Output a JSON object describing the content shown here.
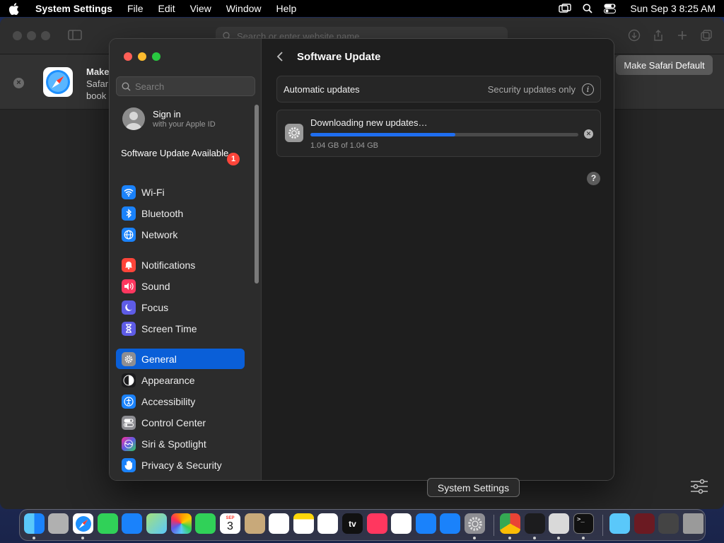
{
  "menubar": {
    "app_name": "System Settings",
    "items": [
      "File",
      "Edit",
      "View",
      "Window",
      "Help"
    ],
    "clock": "Sun Sep 3  8:25 AM"
  },
  "safari": {
    "address_placeholder": "Search or enter website name",
    "banner_title": "Make",
    "banner_line2": "Safar",
    "banner_line3": "book",
    "make_default_label": "Make Safari Default"
  },
  "settings": {
    "search_placeholder": "Search",
    "signin_name": "Sign in",
    "signin_sub": "with your Apple ID",
    "update_available": "Software Update Available",
    "update_badge": "1",
    "nav": [
      {
        "label": "Wi-Fi",
        "icon": "wifi-icon",
        "color": "#1a82fb"
      },
      {
        "label": "Bluetooth",
        "icon": "bluetooth-icon",
        "color": "#1a82fb"
      },
      {
        "label": "Network",
        "icon": "globe-icon",
        "color": "#1a82fb"
      },
      {
        "label": "Notifications",
        "icon": "bell-icon",
        "color": "#ff453a"
      },
      {
        "label": "Sound",
        "icon": "speaker-icon",
        "color": "#ff375f"
      },
      {
        "label": "Focus",
        "icon": "moon-icon",
        "color": "#5e5ce6"
      },
      {
        "label": "Screen Time",
        "icon": "hourglass-icon",
        "color": "#5e5ce6"
      },
      {
        "label": "General",
        "icon": "gear-icon",
        "color": "#8e8e93"
      },
      {
        "label": "Appearance",
        "icon": "appearance-icon",
        "color": "#1c1c1e"
      },
      {
        "label": "Accessibility",
        "icon": "accessibility-icon",
        "color": "#1a82fb"
      },
      {
        "label": "Control Center",
        "icon": "control-center-icon",
        "color": "#8e8e93"
      },
      {
        "label": "Siri & Spotlight",
        "icon": "siri-icon",
        "color": "#bf5af2"
      },
      {
        "label": "Privacy & Security",
        "icon": "hand-icon",
        "color": "#1a82fb"
      }
    ],
    "active_item": "General",
    "page_title": "Software Update",
    "auto_updates_label": "Automatic updates",
    "auto_updates_value": "Security updates only",
    "download_title": "Downloading new updates…",
    "download_size": "1.04 GB of 1.04 GB",
    "download_progress": 0.54
  },
  "tooltip": "System Settings",
  "dock": {
    "apps": [
      "finder-icon",
      "launchpad-icon",
      "safari-icon",
      "messages-icon",
      "mail-icon",
      "maps-icon",
      "photos-icon",
      "facetime-icon",
      "calendar-icon",
      "contacts-icon",
      "reminders-icon",
      "notes-icon",
      "freeform-icon",
      "appletv-icon",
      "music-icon",
      "news-icon",
      "keynote-icon",
      "appstore-icon",
      "system-settings-icon",
      "chrome-icon",
      "instruments-icon",
      "script-editor-icon",
      "terminal-icon",
      "folder-icon",
      "downloads-stack-icon",
      "screenshots-stack-icon",
      "trash-icon"
    ],
    "calendar_day": "3",
    "calendar_month": "SEP",
    "appletv_label": "tv"
  }
}
